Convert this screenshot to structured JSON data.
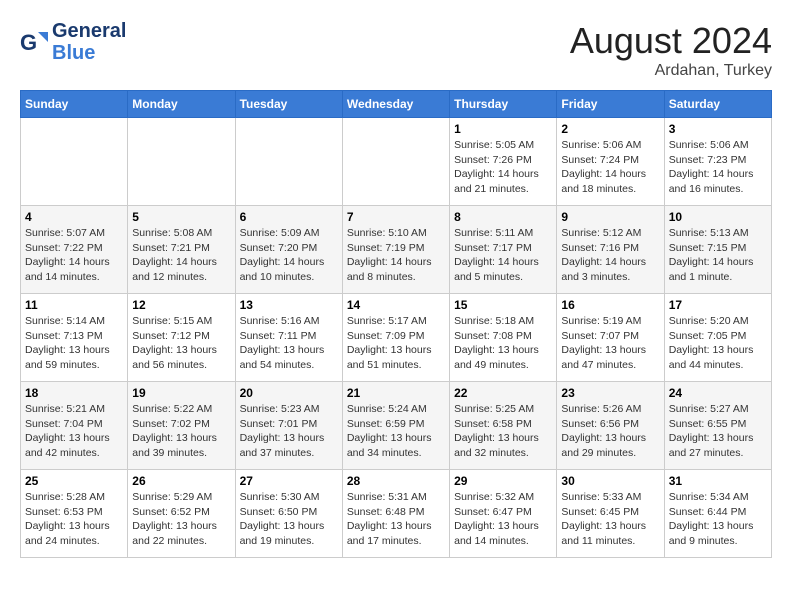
{
  "header": {
    "logo_line1": "General",
    "logo_line2": "Blue",
    "month_title": "August 2024",
    "subtitle": "Ardahan, Turkey"
  },
  "days_of_week": [
    "Sunday",
    "Monday",
    "Tuesday",
    "Wednesday",
    "Thursday",
    "Friday",
    "Saturday"
  ],
  "weeks": [
    [
      {
        "day": "",
        "info": ""
      },
      {
        "day": "",
        "info": ""
      },
      {
        "day": "",
        "info": ""
      },
      {
        "day": "",
        "info": ""
      },
      {
        "day": "1",
        "info": "Sunrise: 5:05 AM\nSunset: 7:26 PM\nDaylight: 14 hours\nand 21 minutes."
      },
      {
        "day": "2",
        "info": "Sunrise: 5:06 AM\nSunset: 7:24 PM\nDaylight: 14 hours\nand 18 minutes."
      },
      {
        "day": "3",
        "info": "Sunrise: 5:06 AM\nSunset: 7:23 PM\nDaylight: 14 hours\nand 16 minutes."
      }
    ],
    [
      {
        "day": "4",
        "info": "Sunrise: 5:07 AM\nSunset: 7:22 PM\nDaylight: 14 hours\nand 14 minutes."
      },
      {
        "day": "5",
        "info": "Sunrise: 5:08 AM\nSunset: 7:21 PM\nDaylight: 14 hours\nand 12 minutes."
      },
      {
        "day": "6",
        "info": "Sunrise: 5:09 AM\nSunset: 7:20 PM\nDaylight: 14 hours\nand 10 minutes."
      },
      {
        "day": "7",
        "info": "Sunrise: 5:10 AM\nSunset: 7:19 PM\nDaylight: 14 hours\nand 8 minutes."
      },
      {
        "day": "8",
        "info": "Sunrise: 5:11 AM\nSunset: 7:17 PM\nDaylight: 14 hours\nand 5 minutes."
      },
      {
        "day": "9",
        "info": "Sunrise: 5:12 AM\nSunset: 7:16 PM\nDaylight: 14 hours\nand 3 minutes."
      },
      {
        "day": "10",
        "info": "Sunrise: 5:13 AM\nSunset: 7:15 PM\nDaylight: 14 hours\nand 1 minute."
      }
    ],
    [
      {
        "day": "11",
        "info": "Sunrise: 5:14 AM\nSunset: 7:13 PM\nDaylight: 13 hours\nand 59 minutes."
      },
      {
        "day": "12",
        "info": "Sunrise: 5:15 AM\nSunset: 7:12 PM\nDaylight: 13 hours\nand 56 minutes."
      },
      {
        "day": "13",
        "info": "Sunrise: 5:16 AM\nSunset: 7:11 PM\nDaylight: 13 hours\nand 54 minutes."
      },
      {
        "day": "14",
        "info": "Sunrise: 5:17 AM\nSunset: 7:09 PM\nDaylight: 13 hours\nand 51 minutes."
      },
      {
        "day": "15",
        "info": "Sunrise: 5:18 AM\nSunset: 7:08 PM\nDaylight: 13 hours\nand 49 minutes."
      },
      {
        "day": "16",
        "info": "Sunrise: 5:19 AM\nSunset: 7:07 PM\nDaylight: 13 hours\nand 47 minutes."
      },
      {
        "day": "17",
        "info": "Sunrise: 5:20 AM\nSunset: 7:05 PM\nDaylight: 13 hours\nand 44 minutes."
      }
    ],
    [
      {
        "day": "18",
        "info": "Sunrise: 5:21 AM\nSunset: 7:04 PM\nDaylight: 13 hours\nand 42 minutes."
      },
      {
        "day": "19",
        "info": "Sunrise: 5:22 AM\nSunset: 7:02 PM\nDaylight: 13 hours\nand 39 minutes."
      },
      {
        "day": "20",
        "info": "Sunrise: 5:23 AM\nSunset: 7:01 PM\nDaylight: 13 hours\nand 37 minutes."
      },
      {
        "day": "21",
        "info": "Sunrise: 5:24 AM\nSunset: 6:59 PM\nDaylight: 13 hours\nand 34 minutes."
      },
      {
        "day": "22",
        "info": "Sunrise: 5:25 AM\nSunset: 6:58 PM\nDaylight: 13 hours\nand 32 minutes."
      },
      {
        "day": "23",
        "info": "Sunrise: 5:26 AM\nSunset: 6:56 PM\nDaylight: 13 hours\nand 29 minutes."
      },
      {
        "day": "24",
        "info": "Sunrise: 5:27 AM\nSunset: 6:55 PM\nDaylight: 13 hours\nand 27 minutes."
      }
    ],
    [
      {
        "day": "25",
        "info": "Sunrise: 5:28 AM\nSunset: 6:53 PM\nDaylight: 13 hours\nand 24 minutes."
      },
      {
        "day": "26",
        "info": "Sunrise: 5:29 AM\nSunset: 6:52 PM\nDaylight: 13 hours\nand 22 minutes."
      },
      {
        "day": "27",
        "info": "Sunrise: 5:30 AM\nSunset: 6:50 PM\nDaylight: 13 hours\nand 19 minutes."
      },
      {
        "day": "28",
        "info": "Sunrise: 5:31 AM\nSunset: 6:48 PM\nDaylight: 13 hours\nand 17 minutes."
      },
      {
        "day": "29",
        "info": "Sunrise: 5:32 AM\nSunset: 6:47 PM\nDaylight: 13 hours\nand 14 minutes."
      },
      {
        "day": "30",
        "info": "Sunrise: 5:33 AM\nSunset: 6:45 PM\nDaylight: 13 hours\nand 11 minutes."
      },
      {
        "day": "31",
        "info": "Sunrise: 5:34 AM\nSunset: 6:44 PM\nDaylight: 13 hours\nand 9 minutes."
      }
    ]
  ]
}
